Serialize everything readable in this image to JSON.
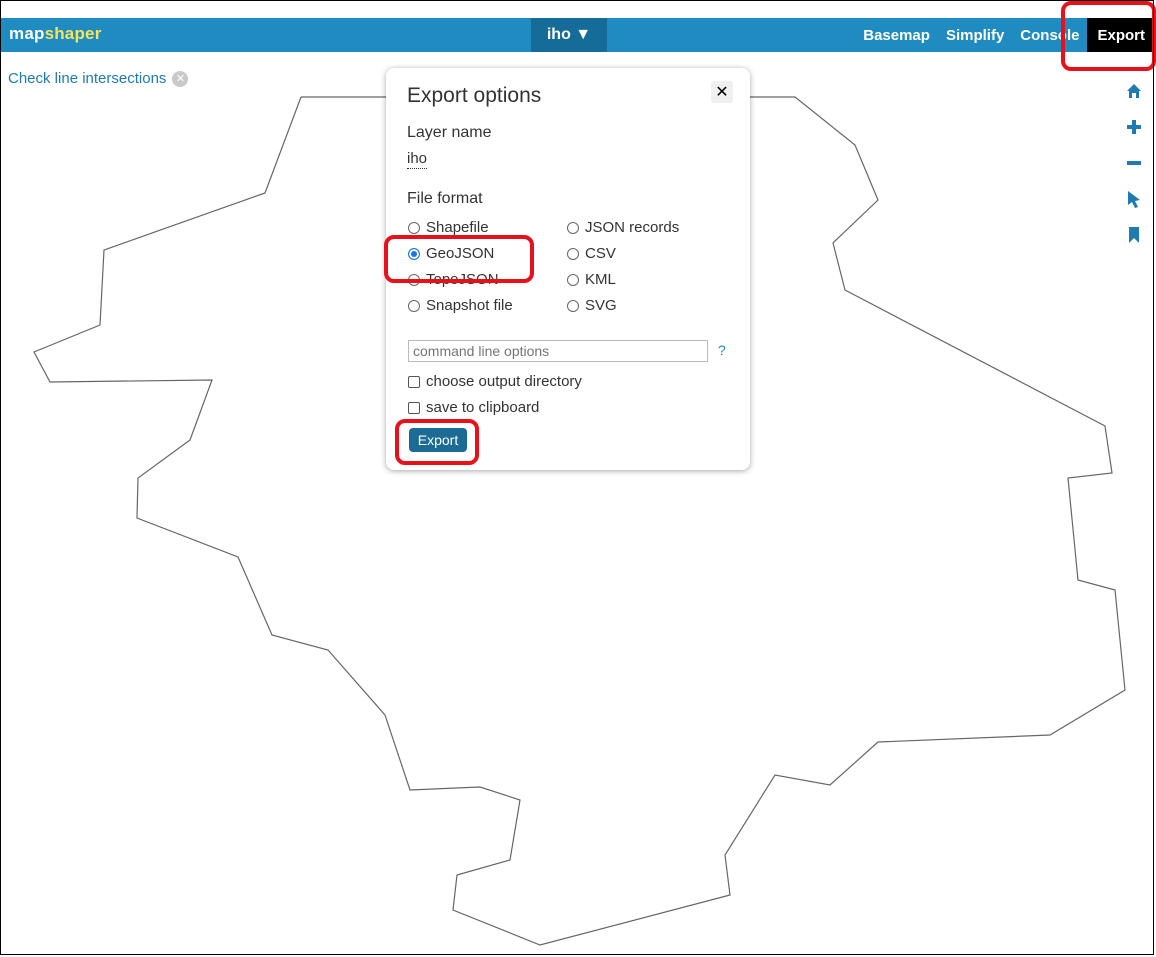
{
  "app": {
    "logo_part1": "map",
    "logo_part2": "shaper"
  },
  "header": {
    "layer_button": "iho ▼",
    "menu": [
      "Basemap",
      "Simplify",
      "Console",
      "Export"
    ]
  },
  "message": {
    "text": "Check line intersections",
    "close": "✕"
  },
  "tools": [
    "home-icon",
    "zoom-in-icon",
    "zoom-out-icon",
    "pointer-icon",
    "bookmark-icon"
  ],
  "dialog": {
    "title": "Export options",
    "close": "✕",
    "layer_name_label": "Layer name",
    "layer_name_value": "iho",
    "file_format_label": "File format",
    "formats_col1": [
      "Shapefile",
      "GeoJSON",
      "TopoJSON",
      "Snapshot file"
    ],
    "formats_col2": [
      "JSON records",
      "CSV",
      "KML",
      "SVG"
    ],
    "selected_format": "GeoJSON",
    "command_placeholder": "command line options",
    "help": "?",
    "checkbox1": "choose output directory",
    "checkbox2": "save to clipboard",
    "export_button": "Export"
  },
  "colors": {
    "header": "#1f8bc0",
    "annotation": "#e8101a",
    "accent": "#1f7ab0"
  }
}
